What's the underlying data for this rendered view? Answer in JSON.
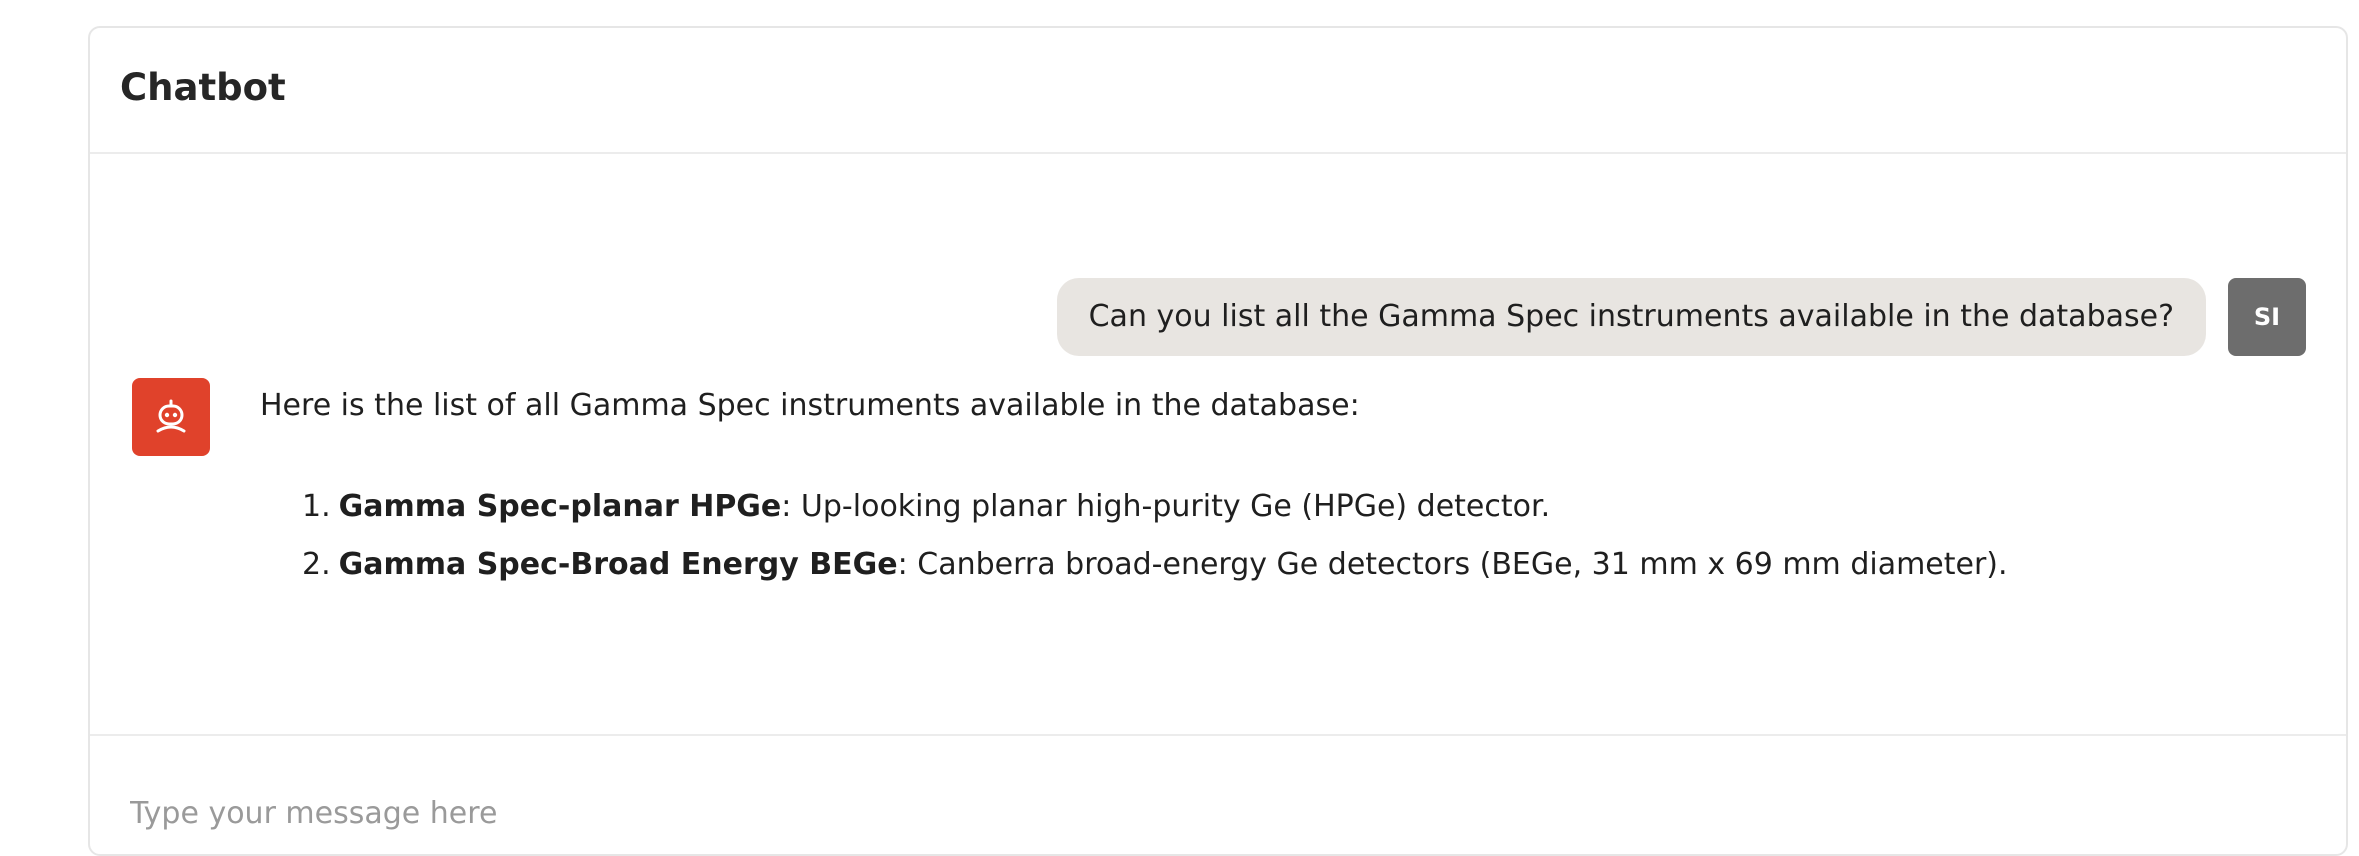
{
  "header": {
    "title": "Chatbot"
  },
  "messages": [
    {
      "role": "user",
      "avatar_initials": "SI",
      "text": "Can you list all the Gamma Spec instruments available in the database?"
    },
    {
      "role": "bot",
      "avatar_icon": "robot-icon",
      "intro": "Here is the list of all Gamma Spec instruments available in the database:",
      "items": [
        {
          "number": "1.",
          "name": "Gamma Spec-planar HPGe",
          "description": ": Up-looking planar high-purity Ge (HPGe) detector."
        },
        {
          "number": "2.",
          "name": "Gamma Spec-Broad Energy BEGe",
          "description": ": Canberra broad-energy Ge detectors (BEGe, 31 mm x 69 mm diameter)."
        }
      ]
    }
  ],
  "input": {
    "placeholder": "Type your message here",
    "value": ""
  },
  "colors": {
    "bot_avatar_bg": "#e0422b",
    "user_avatar_bg": "#6d6d6d",
    "user_bubble_bg": "#e8e5e1"
  }
}
